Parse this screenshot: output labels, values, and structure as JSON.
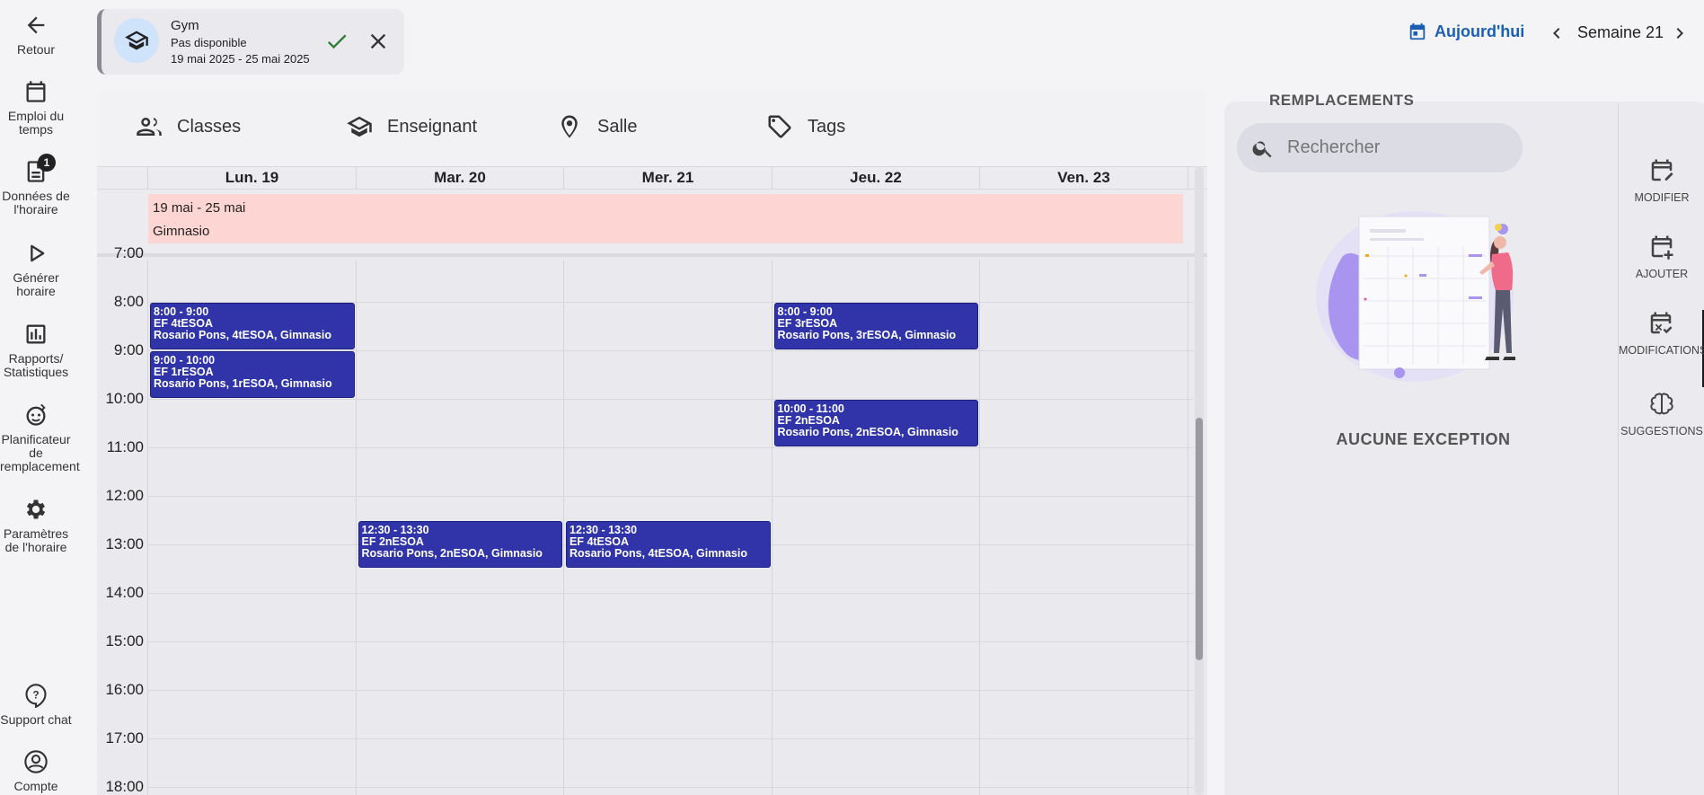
{
  "nav": {
    "back": "Retour",
    "timetable": "Emploi du temps",
    "schedule_data": "Données de l'horaire",
    "schedule_data_badge": "1",
    "generate": "Générer horaire",
    "reports": "Rapports/ Statistiques",
    "planner": "Planificateur de remplacement",
    "settings": "Paramètres de l'horaire",
    "support": "Support chat",
    "account": "Compte"
  },
  "entity": {
    "name": "Gym",
    "status": "Pas disponible",
    "dates": "19 mai 2025 - 25 mai 2025",
    "icon": "school-icon"
  },
  "week_nav": {
    "today": "Aujourd'hui",
    "week": "Semaine 21"
  },
  "filters": [
    {
      "label": "Classes",
      "icon": "people-icon"
    },
    {
      "label": "Enseignant",
      "icon": "school-icon"
    },
    {
      "label": "Salle",
      "icon": "location-icon"
    },
    {
      "label": "Tags",
      "icon": "tag-icon"
    }
  ],
  "days": [
    "Lun. 19",
    "Mar. 20",
    "Mer. 21",
    "Jeu. 22",
    "Ven. 23"
  ],
  "allday": {
    "line1": "19 mai - 25 mai",
    "line2": "Gimnasio"
  },
  "hours": [
    "7:00",
    "8:00",
    "9:00",
    "10:00",
    "11:00",
    "12:00",
    "13:00",
    "14:00",
    "15:00",
    "16:00",
    "17:00",
    "18:00"
  ],
  "events": [
    {
      "day": 0,
      "start": 8,
      "end": 9,
      "time": "8:00 - 9:00",
      "subject": "EF 4tESOA",
      "detail": "Rosario Pons, 4tESOA, Gimnasio"
    },
    {
      "day": 0,
      "start": 9,
      "end": 10,
      "time": "9:00 - 10:00",
      "subject": "EF 1rESOA",
      "detail": "Rosario Pons, 1rESOA, Gimnasio"
    },
    {
      "day": 3,
      "start": 8,
      "end": 9,
      "time": "8:00 - 9:00",
      "subject": "EF 3rESOA",
      "detail": "Rosario Pons, 3rESOA, Gimnasio"
    },
    {
      "day": 3,
      "start": 10,
      "end": 11,
      "time": "10:00 - 11:00",
      "subject": "EF 2nESOA",
      "detail": "Rosario Pons, 2nESOA, Gimnasio"
    },
    {
      "day": 1,
      "start": 12.5,
      "end": 13.5,
      "time": "12:30 - 13:30",
      "subject": "EF 2nESOA",
      "detail": "Rosario Pons, 2nESOA, Gimnasio"
    },
    {
      "day": 2,
      "start": 12.5,
      "end": 13.5,
      "time": "12:30 - 13:30",
      "subject": "EF 4tESOA",
      "detail": "Rosario Pons, 4tESOA, Gimnasio"
    }
  ],
  "right": {
    "title": "REMPLACEMENTS",
    "search_placeholder": "Rechercher",
    "empty": "AUCUNE EXCEPTION"
  },
  "side_tabs": [
    {
      "label": "MODIFIER",
      "icon": "calendar-edit-icon"
    },
    {
      "label": "AJOUTER",
      "icon": "calendar-add-icon"
    },
    {
      "label": "MODIFICATIONS",
      "icon": "calendar-check-icon",
      "active": true
    },
    {
      "label": "SUGGESTIONS",
      "icon": "brain-icon"
    }
  ],
  "colors": {
    "accent": "#1a5fb4",
    "event": "#3034a8",
    "allday": "#fdd5d2"
  }
}
